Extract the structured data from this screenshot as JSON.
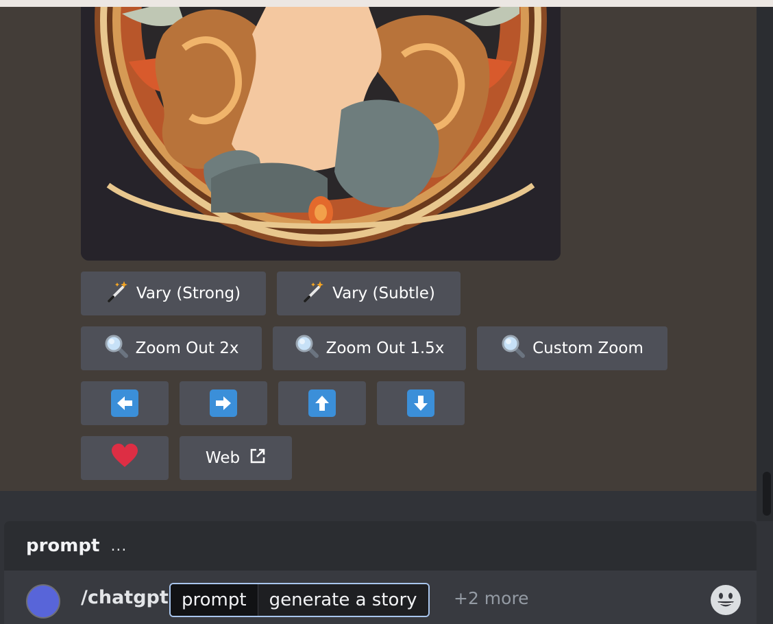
{
  "buttons": {
    "row1": [
      {
        "label": "Vary (Strong)",
        "icon": "magic-wand-icon"
      },
      {
        "label": "Vary (Subtle)",
        "icon": "magic-wand-icon"
      }
    ],
    "row2": [
      {
        "label": "Zoom Out 2x",
        "icon": "magnifier-icon"
      },
      {
        "label": "Zoom Out 1.5x",
        "icon": "magnifier-icon"
      },
      {
        "label": "Custom Zoom",
        "icon": "magnifier-icon"
      }
    ],
    "row3": [
      {
        "icon": "arrow-left-icon"
      },
      {
        "icon": "arrow-right-icon"
      },
      {
        "icon": "arrow-up-icon"
      },
      {
        "icon": "arrow-down-icon"
      }
    ],
    "row4": {
      "favorite_icon": "heart-icon",
      "web_label": "Web",
      "web_icon": "external-link-icon"
    }
  },
  "command_box": {
    "header_title": "prompt",
    "header_dots": "...",
    "command": "/chatgpt",
    "option_key": "prompt",
    "option_value": "generate a story",
    "more_options": "+2 more",
    "emoji_icon": "smiley-icon"
  },
  "colors": {
    "message_bg": "#433d38",
    "button_bg": "#4e5058",
    "arrow_blue": "#3b8fd9",
    "heart_red": "#dd2e44",
    "chip_border": "#a9c6ee"
  }
}
